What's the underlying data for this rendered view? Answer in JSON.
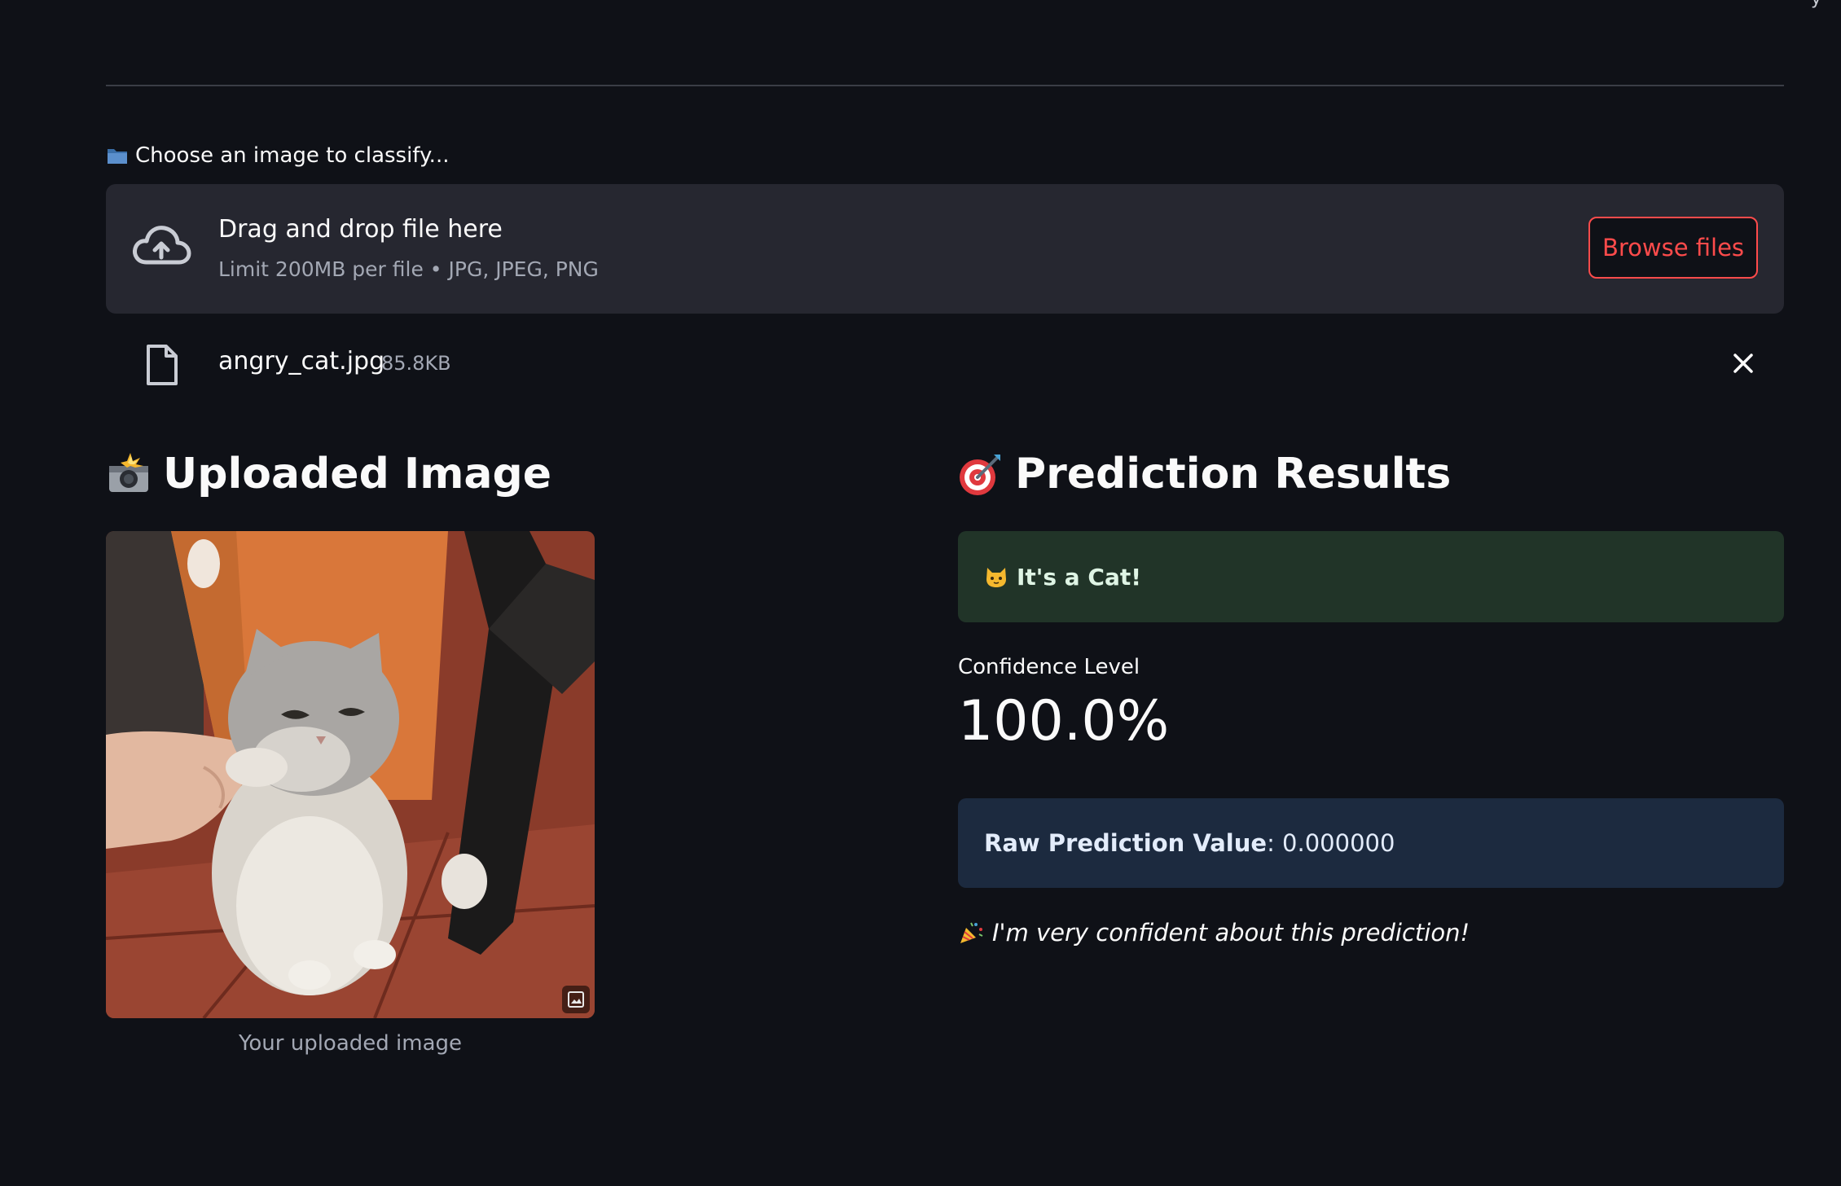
{
  "header": {
    "corner_text": "y"
  },
  "uploader": {
    "label_icon": "folder-icon",
    "label": "Choose an image to classify...",
    "drop_title": "Drag and drop file here",
    "drop_limits": "Limit 200MB per file • JPG, JPEG, PNG",
    "browse_label": "Browse files",
    "file": {
      "name": "angry_cat.jpg",
      "size": "85.8KB"
    }
  },
  "uploaded_section": {
    "icon": "camera-flash-icon",
    "title": "Uploaded Image",
    "caption": "Your uploaded image"
  },
  "prediction_section": {
    "icon": "target-icon",
    "title": "Prediction Results",
    "result_icon": "cat-face-icon",
    "result_text": "It's a Cat!",
    "metric_label": "Confidence Level",
    "metric_value": "100.0%",
    "raw_label": "Raw Prediction Value",
    "raw_value": ": 0.000000",
    "note_icon": "party-popper-icon",
    "note_text": "I'm very confident about this prediction!"
  },
  "colors": {
    "background": "#0f1117",
    "accent": "#ff4b4b",
    "success_bg": "#213428",
    "info_bg": "#1c2a3f",
    "dropzone_bg": "#262730"
  }
}
